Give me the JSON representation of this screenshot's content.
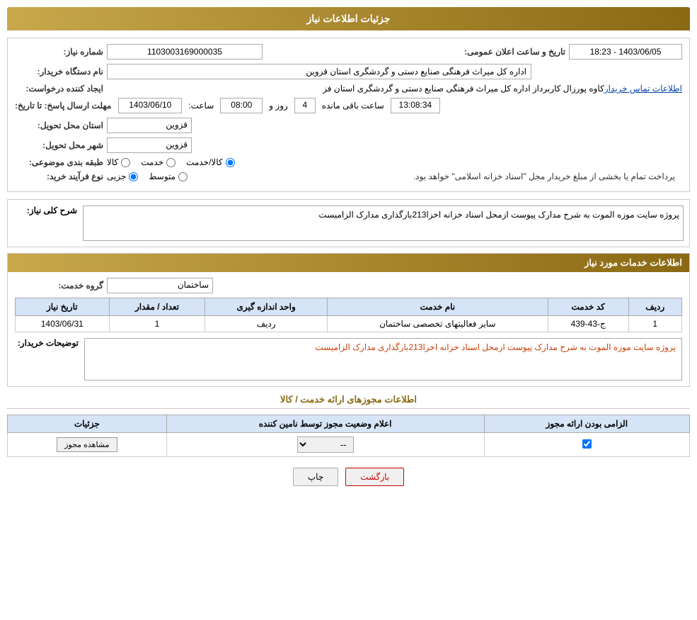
{
  "header": {
    "title": "جزئیات اطلاعات نیاز"
  },
  "need_info": {
    "need_number_label": "شماره نیاز:",
    "need_number_value": "1103003169000035",
    "announcement_label": "تاریخ و ساعت اعلان عمومی:",
    "announcement_value": "1403/06/05 - 18:23",
    "buyer_org_label": "نام دستگاه خریدار:",
    "buyer_org_value": "اداره کل میراث فرهنگی  صنایع دستی و گردشگری استان قزوین",
    "creator_label": "ایجاد کننده درخواست:",
    "creator_value": "کاوه پورزال کاربرداز اداره کل میراث فرهنگی  صنایع دستی و گردشگری استان فز",
    "creator_link": "اطلاعات تماس خریدار",
    "deadline_label": "مهلت ارسال پاسخ: تا تاریخ:",
    "deadline_date": "1403/06/10",
    "deadline_time_label": "ساعت:",
    "deadline_time": "08:00",
    "deadline_days_label": "روز و",
    "deadline_days": "4",
    "deadline_remaining_label": "ساعت باقی مانده",
    "deadline_remaining": "13:08:34",
    "province_label": "استان محل تحویل:",
    "province_value": "قزوین",
    "city_label": "شهر محل تحویل:",
    "city_value": "قزوین",
    "category_label": "طبقه بندی موضوعی:",
    "category_goods": "کالا",
    "category_service": "خدمت",
    "category_goods_service": "کالا/خدمت",
    "purchase_type_label": "نوع فرآیند خرید:",
    "purchase_partial": "جزیی",
    "purchase_medium": "متوسط",
    "purchase_note": "پرداخت تمام یا بخشی از مبلغ خریدار مجل \"اسناد خزانه اسلامی\" خواهد بود.",
    "general_need_label": "شرح کلی نیاز:",
    "general_need_value": "پروژه سایت موزه الموت به شرح مدارک پیوست ازمحل اسناد خزانه اخزا213بارگذاری مدارک الزامیست"
  },
  "service_info": {
    "title": "اطلاعات خدمات مورد نیاز",
    "service_group_label": "گروه خدمت:",
    "service_group_value": "ساختمان",
    "table": {
      "headers": [
        "ردیف",
        "کد خدمت",
        "نام خدمت",
        "واحد اندازه گیری",
        "تعداد / مقدار",
        "تاریخ نیاز"
      ],
      "rows": [
        {
          "row_num": "1",
          "service_code": "ج-43-439",
          "service_name": "سایر فعالیتهای تخصصی ساختمان",
          "unit": "ردیف",
          "quantity": "1",
          "need_date": "1403/06/31"
        }
      ]
    },
    "buyer_desc_label": "توضیحات خریدار:",
    "buyer_desc_value": "پروژه سایت موزه الموت به شرح مدارک پیوست ازمحل اسناد خزانه اخزا213بارگذاری مدارک الزامیست"
  },
  "permits_section": {
    "title": "اطلاعات مجوزهای ارائه خدمت / کالا",
    "table": {
      "headers": [
        "الزامی بودن ارائه مجوز",
        "اعلام وضعیت مجوز توسط نامین کننده",
        "جزئیات"
      ],
      "rows": [
        {
          "required": true,
          "status": "--",
          "detail_label": "مشاهده مجوز"
        }
      ]
    }
  },
  "buttons": {
    "print": "چاپ",
    "back": "بازگشت"
  }
}
